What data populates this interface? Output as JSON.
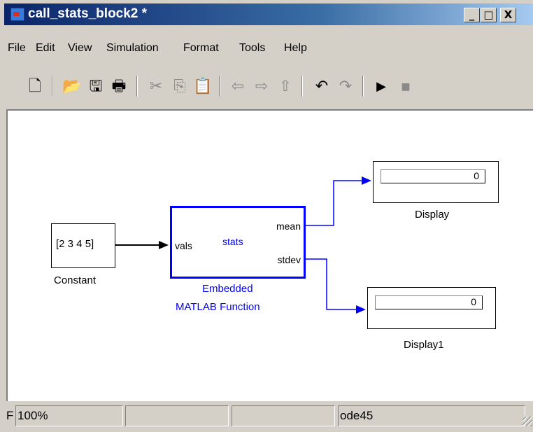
{
  "window": {
    "title": "call_stats_block2 *",
    "buttons": {
      "minimize": "_",
      "maximize": "□",
      "close": "X"
    }
  },
  "menu": {
    "items": [
      "File",
      "Edit",
      "View",
      "Simulation",
      "Format",
      "Tools",
      "Help"
    ]
  },
  "toolbar": {
    "icons": [
      "new-icon",
      "open-icon",
      "save-icon",
      "print-icon",
      "cut-icon",
      "copy-icon",
      "paste-icon",
      "back-icon",
      "forward-icon",
      "up-icon",
      "undo-icon",
      "redo-icon",
      "start-simulation-icon",
      "stop-simulation-icon"
    ]
  },
  "model": {
    "constant": {
      "value": "[2 3 4 5]",
      "label": "Constant"
    },
    "function_block": {
      "name": "stats",
      "input_port": "vals",
      "output_port_1": "mean",
      "output_port_2": "stdev",
      "label_line1": "Embedded",
      "label_line2": "MATLAB Function",
      "color": "#0000ff"
    },
    "display": {
      "value": "0",
      "label": "Display"
    },
    "display1": {
      "value": "0",
      "label": "Display1"
    },
    "signal_colors": {
      "constant_line": "#000000",
      "output_lines": "#0000ff"
    }
  },
  "status": {
    "first": "F",
    "zoom": "100%",
    "cell3": "",
    "cell4": "",
    "solver": "ode45"
  }
}
